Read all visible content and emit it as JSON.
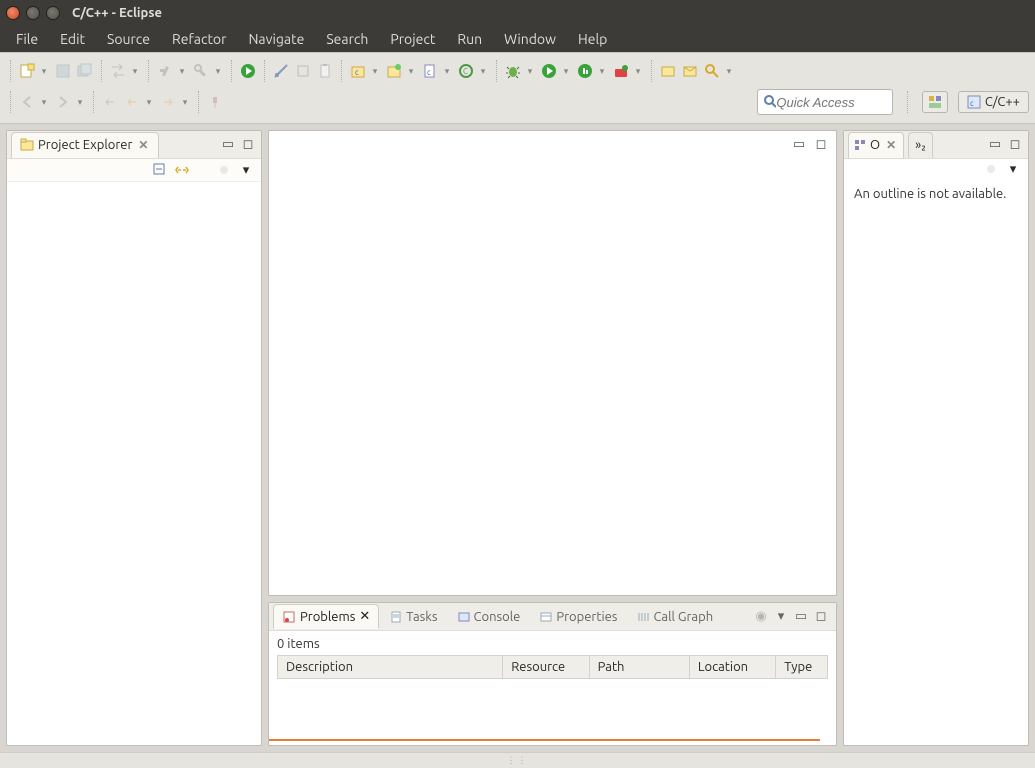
{
  "window": {
    "title": "C/C++ - Eclipse"
  },
  "menu": {
    "items": [
      "File",
      "Edit",
      "Source",
      "Refactor",
      "Navigate",
      "Search",
      "Project",
      "Run",
      "Window",
      "Help"
    ]
  },
  "quick_access": {
    "placeholder": "Quick Access"
  },
  "perspective": {
    "current": "C/C++"
  },
  "left_panel": {
    "tab_label": "Project Explorer"
  },
  "right_panel": {
    "tab1_label": "O",
    "tab2_label": "»₂",
    "body_text": "An outline is not available."
  },
  "bottom_panel": {
    "tabs": {
      "problems": "Problems",
      "tasks": "Tasks",
      "console": "Console",
      "properties": "Properties",
      "callgraph": "Call Graph"
    },
    "problems_count_label": "0 items",
    "columns": {
      "description": "Description",
      "resource": "Resource",
      "path": "Path",
      "location": "Location",
      "type": "Type"
    }
  }
}
